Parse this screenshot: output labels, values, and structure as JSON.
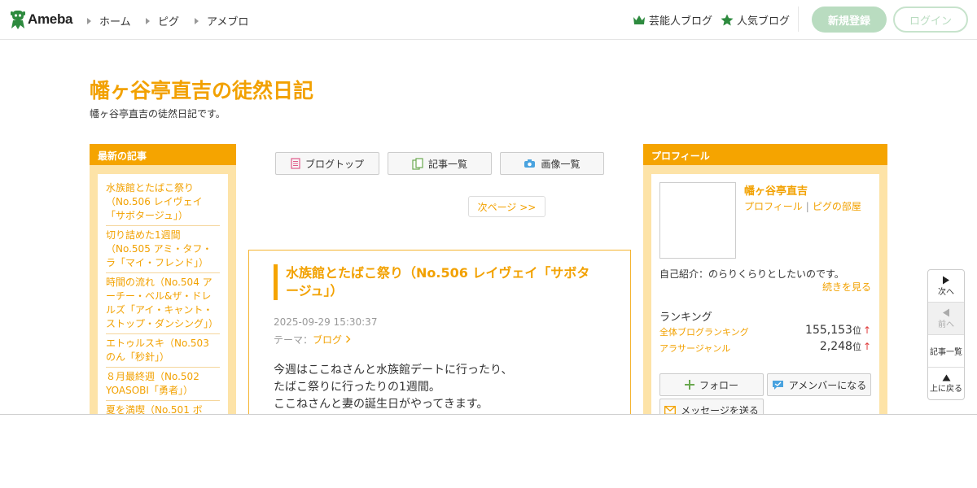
{
  "header": {
    "logo_text": "Ameba",
    "nav": [
      "ホーム",
      "ピグ",
      "アメブロ"
    ],
    "celebrity_blog": "芸能人ブログ",
    "popular_blog": "人気ブログ",
    "register": "新規登録",
    "login": "ログイン",
    "colors": {
      "brand_green": "#2d8a3e",
      "register_bg": "#b9dcc0"
    }
  },
  "blog": {
    "title": "幡ヶ谷亭直吉の徒然日記",
    "description": "幡ヶ谷亭直吉の徒然日記です。"
  },
  "recent": {
    "heading": "最新の記事",
    "items": [
      "水族館とたばこ祭り（No.506 レイヴェイ「サボタージュ」）",
      "切り詰めた1週間（No.505 アミ・タフ・ラ「マイ・フレンド」）",
      "時間の流れ（No.504 アーチー・ベル&ザ・ドレルズ「アイ・キャント・ストップ・ダンシング」）",
      "エトゥルスキ（No.503 のん「秒針」）",
      "８月最終週（No.502 YOASOBI「勇者」）",
      "夏を満喫（No.501 ボ"
    ]
  },
  "toolbar": {
    "blog_top": "ブログトップ",
    "articles": "記事一覧",
    "images": "画像一覧",
    "next_page": "次ページ >>"
  },
  "article": {
    "title": "水族館とたばこ祭り（No.506 レイヴェイ「サボタージュ」）",
    "date": "2025-09-29 15:30:37",
    "theme_label": "テーマ：",
    "theme": "ブログ",
    "body": [
      "今週はここねさんと水族館デートに行ったり、",
      "たばこ祭りに行ったりの1週間。",
      "ここねさんと妻の誕生日がやってきます。"
    ]
  },
  "profile": {
    "heading": "プロフィール",
    "name": "幡ヶ谷亭直吉",
    "link_profile": "プロフィール",
    "link_pig": "ピグの部屋",
    "self_intro": "自己紹介：のらりくらりとしたいのです。",
    "read_more": "続きを見る",
    "ranking_label": "ランキング",
    "ranks": [
      {
        "label": "全体ブログランキング",
        "value": "155,153",
        "unit": "位",
        "trend": "↑"
      },
      {
        "label": "アラサージャンル",
        "value": "2,248",
        "unit": "位",
        "trend": "↑"
      }
    ],
    "follow": "フォロー",
    "amember": "アメンバーになる",
    "message": "メッセージを送る"
  },
  "float_nav": {
    "next": "次へ",
    "prev": "前へ",
    "list": "記事一覧",
    "top": "上に戻る"
  }
}
